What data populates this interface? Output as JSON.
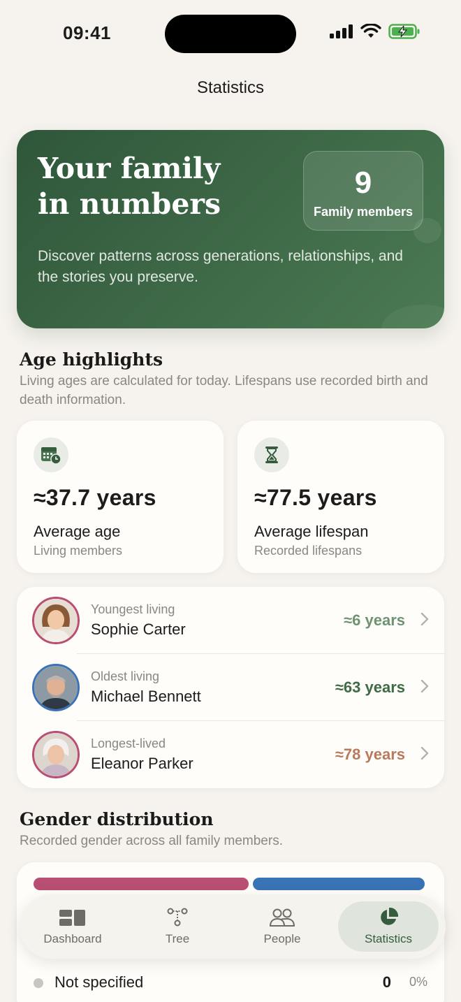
{
  "status_bar": {
    "time": "09:41"
  },
  "nav": {
    "title": "Statistics"
  },
  "hero": {
    "title_line1": "Your family",
    "title_line2": "in numbers",
    "subtitle": "Discover patterns across generations, relationships, and the stories you preserve.",
    "badge_value": "9",
    "badge_label": "Family members"
  },
  "age_highlights": {
    "title": "Age highlights",
    "subtitle": "Living ages are calculated for today. Lifespans use recorded birth and death information.",
    "cards": [
      {
        "icon": "calendar-clock-icon",
        "value": "≈37.7 years",
        "label": "Average age",
        "sub": "Living members"
      },
      {
        "icon": "hourglass-icon",
        "value": "≈77.5 years",
        "label": "Average lifespan",
        "sub": "Recorded lifespans"
      }
    ],
    "people": [
      {
        "role": "Youngest living",
        "name": "Sophie Carter",
        "age": "≈6 years",
        "age_color": "#6e9373",
        "ring": "#b94e73"
      },
      {
        "role": "Oldest living",
        "name": "Michael Bennett",
        "age": "≈63 years",
        "age_color": "#3e6a46",
        "ring": "#3a73b5"
      },
      {
        "role": "Longest-lived",
        "name": "Eleanor Parker",
        "age": "≈78 years",
        "age_color": "#b77a5c",
        "ring": "#b94e73"
      }
    ]
  },
  "gender": {
    "title": "Gender distribution",
    "subtitle": "Recorded gender across all family members.",
    "colors": {
      "female": "#b94e73",
      "male": "#3a73b5",
      "unspecified": "#c9c6c1"
    },
    "not_specified": {
      "label": "Not specified",
      "count": "0",
      "percent": "0%"
    }
  },
  "tabs": [
    {
      "label": "Dashboard",
      "icon": "dashboard-icon",
      "active": false
    },
    {
      "label": "Tree",
      "icon": "tree-icon",
      "active": false
    },
    {
      "label": "People",
      "icon": "people-icon",
      "active": false
    },
    {
      "label": "Statistics",
      "icon": "pie-chart-icon",
      "active": true
    }
  ],
  "colors": {
    "accent": "#355c3c",
    "background": "#f6f3ee"
  }
}
